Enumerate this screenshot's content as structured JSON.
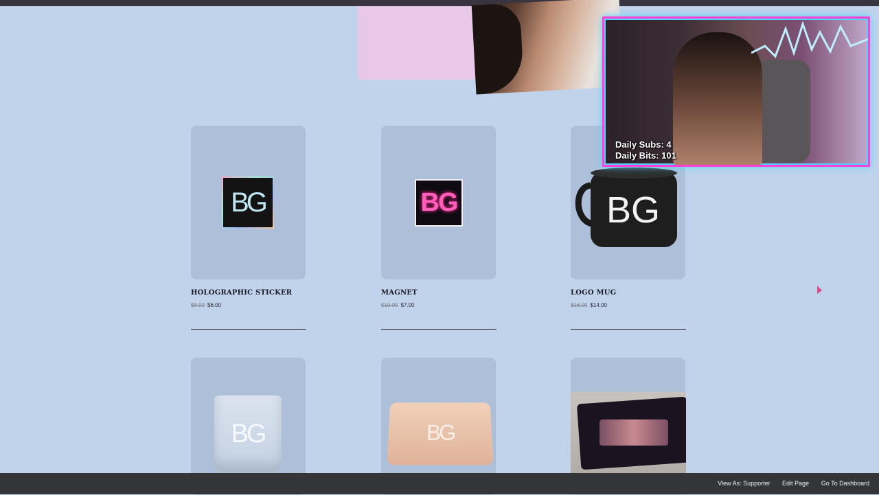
{
  "stream_overlay": {
    "daily_subs": "Daily Subs: 4",
    "daily_bits": "Daily Bits: 101"
  },
  "products": [
    {
      "title": "HOLOGRAPHIC STICKER",
      "old_price": "$8.00",
      "price": "$6.00",
      "logo": "BG"
    },
    {
      "title": "MAGNET",
      "old_price": "$10.00",
      "price": "$7.00",
      "logo": "BG"
    },
    {
      "title": "LOGO MUG",
      "old_price": "$16.00",
      "price": "$14.00",
      "logo": "BG"
    }
  ],
  "row2_logos": [
    "BG",
    "BG"
  ],
  "admin_bar": {
    "view_as": "View As: Supporter",
    "edit_page": "Edit Page",
    "dashboard": "Go To Dashboard"
  },
  "colors": {
    "background": "#c1d3eb",
    "card": "#aec0d9",
    "overlay_border": "#ff3fd6",
    "overlay_glow": "#4fd3ff"
  }
}
